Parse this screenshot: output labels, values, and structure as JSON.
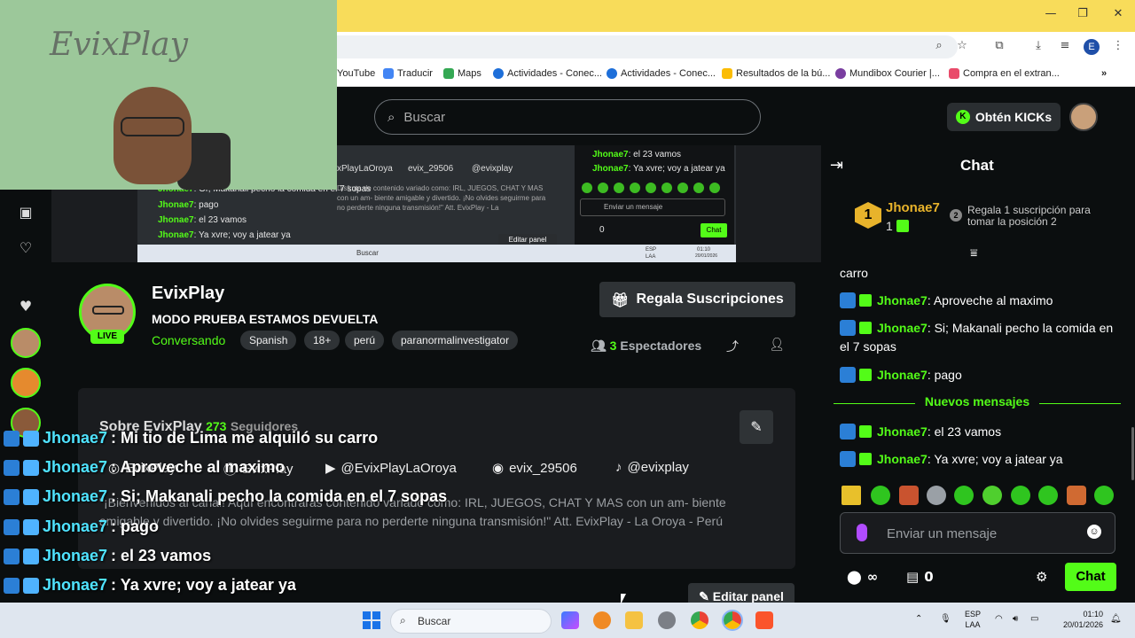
{
  "browser": {
    "bookmarks": [
      "YouTube",
      "Traducir",
      "Maps",
      "Actividades - Conec...",
      "Actividades - Conec...",
      "Resultados de la bú...",
      "Mundibox Courier |...",
      "Compra en el extran..."
    ],
    "profile_initial": "E"
  },
  "header": {
    "search_placeholder": "Buscar",
    "kicks_label": "Obtén KICKs"
  },
  "webcam": {
    "board_text": "EvixPlay"
  },
  "preview": {
    "chat_lines": [
      {
        "user": "Jhonae7",
        "text": ": el 23 vamos"
      },
      {
        "user": "Jhonae7",
        "text": ": Ya xvre; voy a jatear ya"
      }
    ],
    "overlay_lines": [
      {
        "user": "Jhonae7",
        "text": ": Or, Makanali pecho la comida en el 7 sopas"
      },
      {
        "user": "Jhonae7",
        "text": ": pago"
      },
      {
        "user": "Jhonae7",
        "text": ": el 23 vamos"
      },
      {
        "user": "Jhonae7",
        "text": ": Ya xvre; voy a jatear ya"
      }
    ],
    "social": [
      "xPlayLaOroya",
      "evix_29506",
      "@evixplay"
    ],
    "desc": "Disfruta de contenido variado como: IRL, JUEGOS, CHAT Y MAS con un am- biente amigable y divertido. ¡No olvides seguirme para no perderte ninguna transmisión!\" Att. EvixPlay - La",
    "input_placeholder": "Enviar un mensaje",
    "counter": "0",
    "chat_button": "Chat",
    "edit_panel": "Editar panel",
    "taskbar_search": "Buscar",
    "lang": "ESP LAA",
    "time": "01:10",
    "date": "20/01/2026"
  },
  "channel": {
    "name": "EvixPlay",
    "title": "MODO PRUEBA ESTAMOS DEVUELTA",
    "category": "Conversando",
    "live": "LIVE",
    "tags": [
      "Spanish",
      "18+",
      "perú",
      "paranormalinvestigator"
    ],
    "gift_button": "Regala Suscripciones",
    "viewers_count": "3",
    "viewers_label": "Espectadores"
  },
  "about": {
    "title": "Sobre EvixPlay",
    "followers_count": "273",
    "followers_label": "Seguidores",
    "social": {
      "instagram": "EvixPlay",
      "facebook": "EvixPlay",
      "youtube": "@EvixPlayLaOroya",
      "discord": "evix_29506",
      "tiktok": "@evixplay"
    },
    "description": "\"¡Bienvenidos al canal! Aquí encontrarás contenido variado como: IRL, JUEGOS, CHAT Y MAS con un am- biente amigable y divertido. ¡No olvides seguirme para no perderte ninguna transmisión!\" Att. EvixPlay - La Oroya - Perú",
    "edit_panel": "Editar panel"
  },
  "overlay_chat": [
    {
      "user": "Jhonae7",
      "text": ": Mi tio de Lima me alquiló su carro"
    },
    {
      "user": "Jhonae7",
      "text": ": Aproveche al maximo"
    },
    {
      "user": "Jhonae7",
      "text": ": Si; Makanali pecho la comida en el 7 sopas"
    },
    {
      "user": "Jhonae7",
      "text": ": pago"
    },
    {
      "user": "Jhonae7",
      "text": ": el 23 vamos"
    },
    {
      "user": "Jhonae7",
      "text": ": Ya xvre; voy a jatear ya"
    }
  ],
  "chat": {
    "title": "Chat",
    "top_gifter": {
      "rank": "1",
      "name": "Jhonae7",
      "count": "1"
    },
    "rank2": "2",
    "rank2_text": "Regala 1 suscripción para tomar la posición 2",
    "first_line": "carro",
    "messages": [
      {
        "user": "Jhonae7",
        "text": ": Aproveche al maximo"
      },
      {
        "user": "Jhonae7",
        "text": ": Si; Makanali pecho la comida en el 7 sopas"
      },
      {
        "user": "Jhonae7",
        "text": ": pago"
      }
    ],
    "new_messages_label": "Nuevos mensajes",
    "new_messages": [
      {
        "user": "Jhonae7",
        "text": ": el 23 vamos"
      },
      {
        "user": "Jhonae7",
        "text": ": Ya xvre; voy a jatear ya"
      }
    ],
    "input_placeholder": "Enviar un mensaje",
    "points": "∞",
    "drops": "0",
    "send_label": "Chat"
  },
  "taskbar": {
    "search_label": "Buscar",
    "lang_line1": "ESP",
    "lang_line2": "LAA",
    "time": "01:10",
    "date": "20/01/2026"
  },
  "colors": {
    "accent": "#53fc18",
    "background": "#0b0e0f",
    "panel": "#1a1c1f",
    "browser_title": "#f8dc5a"
  }
}
